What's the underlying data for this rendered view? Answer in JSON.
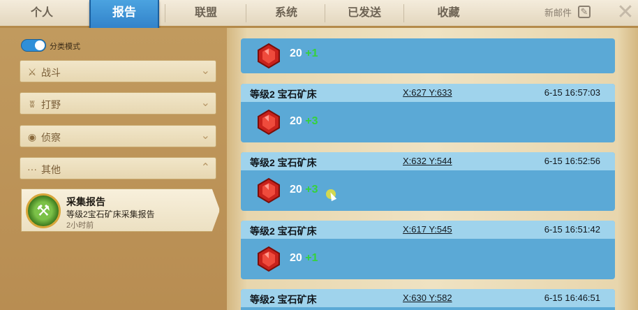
{
  "tabs": {
    "personal": "个人",
    "report": "报告",
    "alliance": "联盟",
    "system": "系统",
    "sent": "已发送",
    "favorites": "收藏"
  },
  "header": {
    "new_mail": "新邮件"
  },
  "sidebar": {
    "toggle_label": "分类模式",
    "categories": [
      {
        "label": "战斗",
        "icon": "crossed-swords-icon"
      },
      {
        "label": "打野",
        "icon": "paw-icon"
      },
      {
        "label": "侦察",
        "icon": "eye-icon"
      },
      {
        "label": "其他",
        "icon": "ellipsis-icon"
      }
    ],
    "report": {
      "title": "采集报告",
      "subtitle": "等级2宝石矿床采集报告",
      "time": "2小时前"
    }
  },
  "entries": [
    {
      "title": "",
      "coords": "",
      "time": "",
      "amount": "20",
      "bonus": "+1"
    },
    {
      "title": "等级2 宝石矿床",
      "coords": "X:627 Y:633",
      "time": "6-15 16:57:03",
      "amount": "20",
      "bonus": "+3"
    },
    {
      "title": "等级2 宝石矿床",
      "coords": "X:632 Y:544",
      "time": "6-15 16:52:56",
      "amount": "20",
      "bonus": "+3"
    },
    {
      "title": "等级2 宝石矿床",
      "coords": "X:617 Y:545",
      "time": "6-15 16:51:42",
      "amount": "20",
      "bonus": "+1"
    },
    {
      "title": "等级2 宝石矿床",
      "coords": "X:630 Y:582",
      "time": "6-15 16:46:51",
      "amount": "",
      "bonus": ""
    }
  ],
  "colors": {
    "accent": "#2d7cc5",
    "entry_bg": "#5ba9d6",
    "entry_head": "#9fd3ec",
    "bonus": "#35d23b"
  }
}
